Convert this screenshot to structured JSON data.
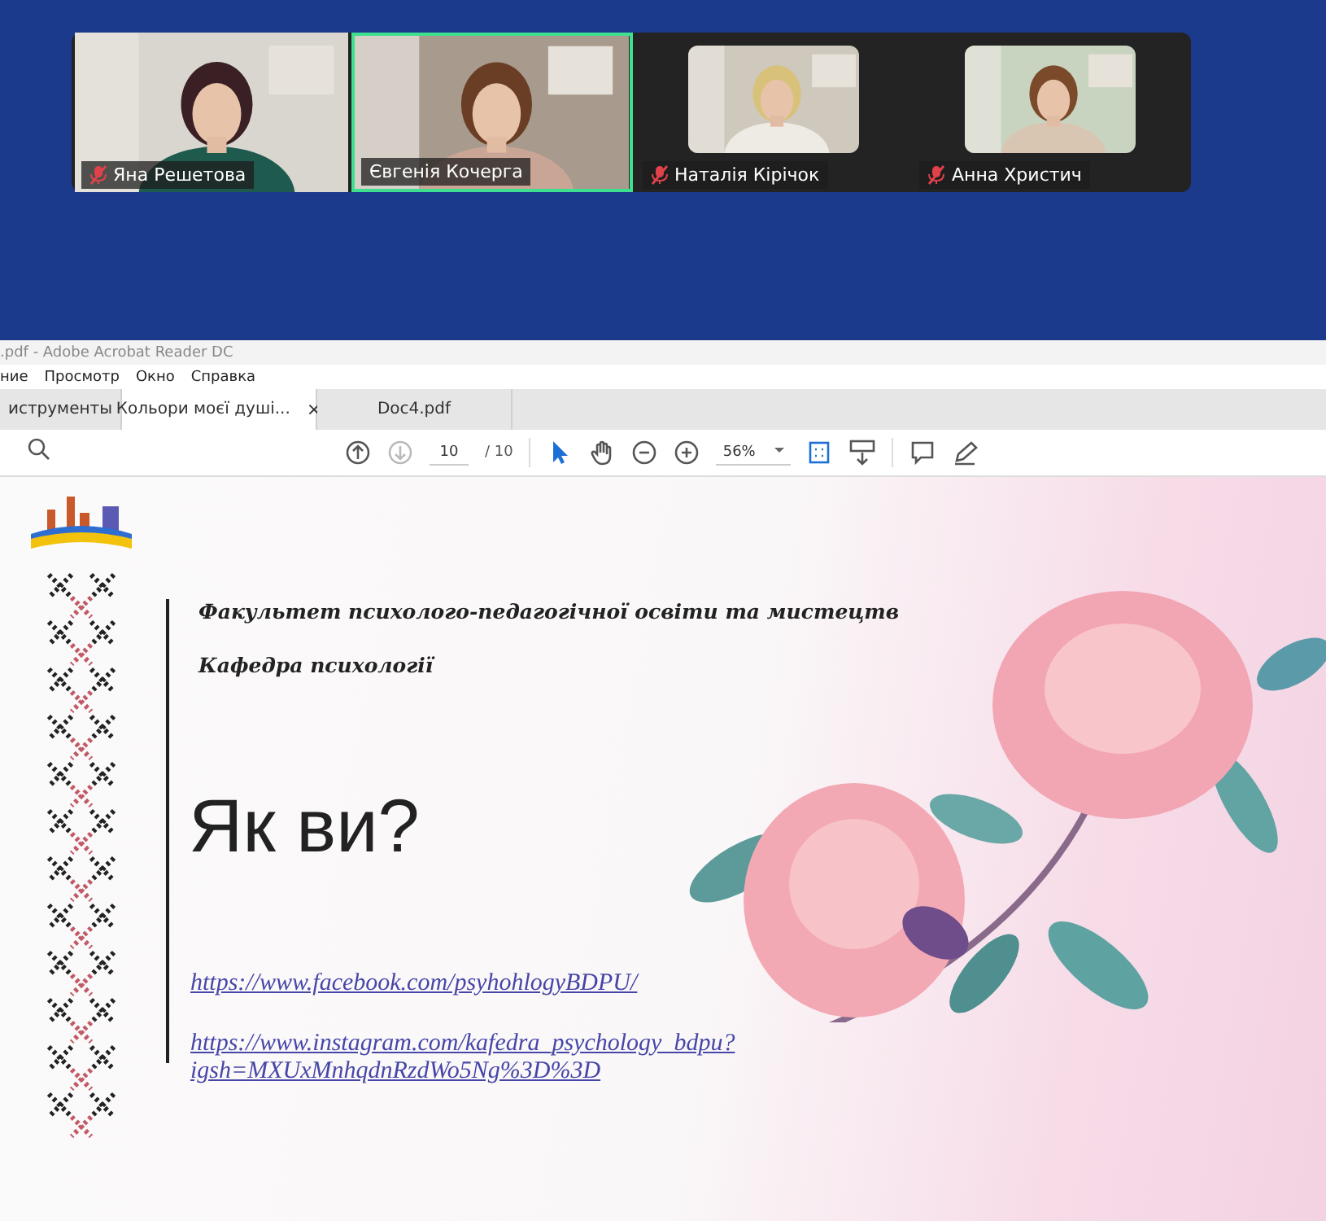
{
  "participants": [
    {
      "name": "Яна Решетова",
      "muted": true,
      "active": false,
      "kind": "full"
    },
    {
      "name": "Євгенія Кочерга",
      "muted": false,
      "active": true,
      "kind": "full"
    },
    {
      "name": "Наталія Кірічок",
      "muted": true,
      "active": false,
      "kind": "small"
    },
    {
      "name": "Анна Христич",
      "muted": true,
      "active": false,
      "kind": "small"
    }
  ],
  "window": {
    "title": ".pdf - Adobe Acrobat Reader DC"
  },
  "menu": [
    "ние",
    "Просмотр",
    "Окно",
    "Справка"
  ],
  "tabs": [
    {
      "label": "иструменты",
      "selected": false
    },
    {
      "label": "Кольори моєї душі...",
      "selected": true,
      "close": "×"
    },
    {
      "label": "Doc4.pdf",
      "selected": false
    }
  ],
  "toolbar": {
    "nav": [
      {
        "kind": "up",
        "disabled": false
      },
      {
        "kind": "down",
        "disabled": true
      }
    ],
    "page": "10",
    "page_total": "/ 10",
    "tools": [
      {
        "kind": "select",
        "selected": true
      },
      {
        "kind": "hand",
        "selected": false
      }
    ],
    "zoom": "56%"
  },
  "slide": {
    "faculty": "Факультет психолого-педагогічної освіти та мистецтв",
    "department": "Кафедра психології",
    "heading": "Як ви?",
    "links": [
      "https://www.facebook.com/psyhohlogyBDPU/",
      "https://www.instagram.com/kafedra_psychology_bdpu?igsh=MXUxMnhqdnRzdWo5Ng%3D%3D"
    ]
  }
}
